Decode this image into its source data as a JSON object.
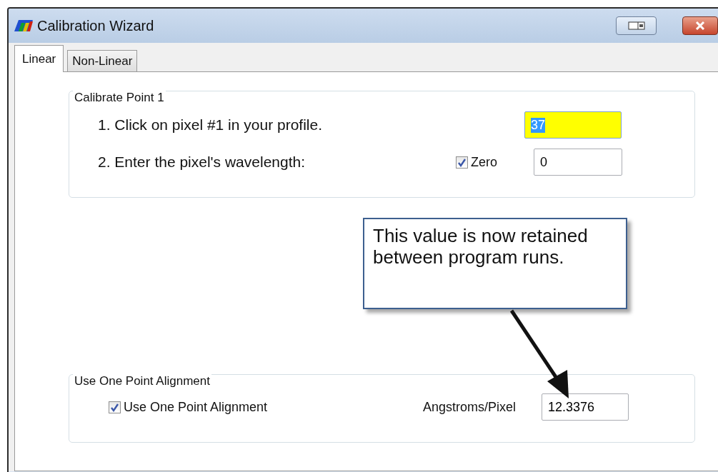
{
  "window": {
    "title": "Calibration Wizard"
  },
  "tabs": [
    {
      "label": "Linear",
      "selected": true
    },
    {
      "label": "Non-Linear",
      "selected": false
    }
  ],
  "calibrate_point": {
    "title": "Calibrate Point 1",
    "step_1": "1. Click on pixel #1 in your profile.",
    "pixel_field": {
      "value": "37",
      "highlighted": true
    },
    "step_2": "2. Enter the pixel's wavelength:",
    "zero": {
      "label": "Zero",
      "checked": true
    },
    "wavelength_field": {
      "value": "0"
    }
  },
  "callout": {
    "text": "This value is now retained between program runs."
  },
  "one_point": {
    "title": "Use One Point Alignment",
    "checkbox": {
      "label": "Use One Point Alignment",
      "checked": true
    },
    "angstroms_label": "Angstroms/Pixel",
    "angstroms_field": {
      "value": "12.3376"
    }
  }
}
